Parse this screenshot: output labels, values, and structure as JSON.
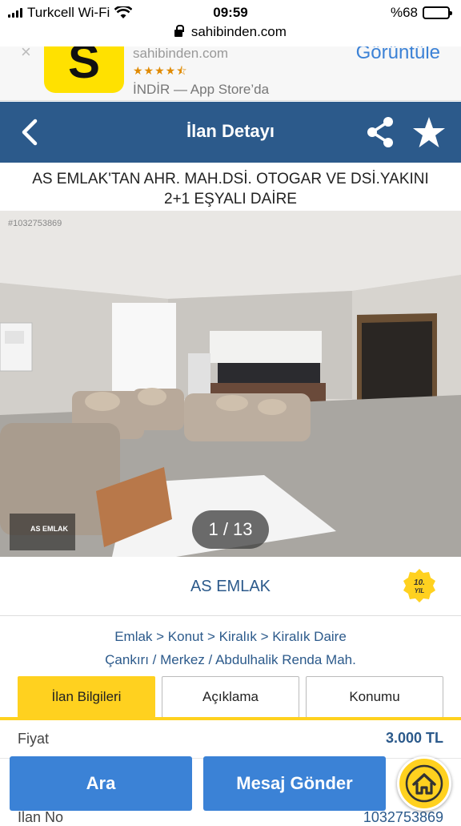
{
  "status_bar": {
    "carrier": "Turkcell Wi-Fi",
    "time": "09:59",
    "battery": "%68",
    "battery_level": 0.68
  },
  "browser": {
    "url": "sahibinden.com"
  },
  "app_banner": {
    "app_name": "sahibinden.com",
    "stars": "★★★★⯪",
    "install_text": "İNDİR — App Store’da",
    "view_label": "Görüntüle"
  },
  "nav": {
    "title": "İlan Detayı"
  },
  "listing": {
    "title_line1": "AS EMLAK'TAN AHR. MAH.DSİ. OTOGAR VE DSİ.YAKINI",
    "title_line2": "2+1 EŞYALI DAİRE",
    "photo_id": "#1032753869",
    "photo_counter": "1 / 13",
    "watermark": "AS EMLAK"
  },
  "seller": {
    "name": "AS EMLAK",
    "badge": "10. YIL"
  },
  "breadcrumb": {
    "line1": "Emlak > Konut > Kiralık > Kiralık Daire",
    "line2": "Çankırı / Merkez / Abdulhalik Renda Mah."
  },
  "tabs": [
    {
      "label": "İlan Bilgileri",
      "active": true
    },
    {
      "label": "Açıklama",
      "active": false
    },
    {
      "label": "Konumu",
      "active": false
    }
  ],
  "details": [
    {
      "key": "Fiyat",
      "value": "3.000 TL"
    }
  ],
  "partial_row": {
    "key": "İlan No",
    "value": "1032753869"
  },
  "actions": {
    "call_label": "Ara",
    "message_label": "Mesaj Gönder"
  },
  "colors": {
    "nav_blue": "#2c5a8b",
    "accent_yellow": "#ffd11f",
    "button_blue": "#3b82d6"
  }
}
